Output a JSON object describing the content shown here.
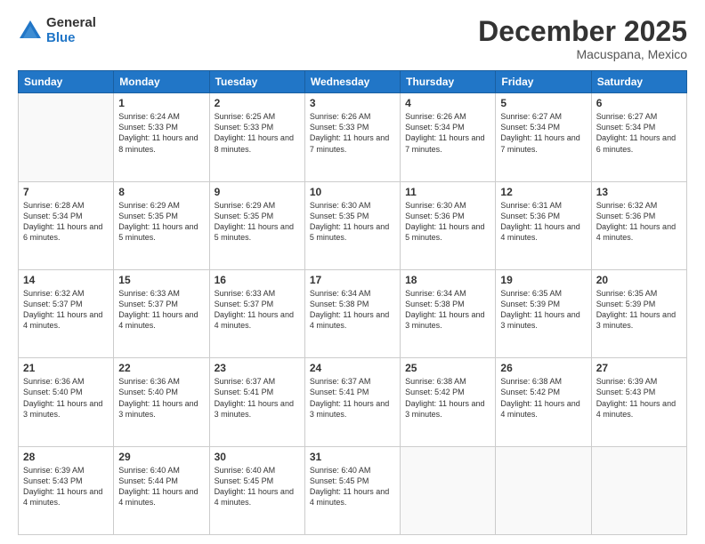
{
  "header": {
    "logo_general": "General",
    "logo_blue": "Blue",
    "month_title": "December 2025",
    "location": "Macuspana, Mexico"
  },
  "days_of_week": [
    "Sunday",
    "Monday",
    "Tuesday",
    "Wednesday",
    "Thursday",
    "Friday",
    "Saturday"
  ],
  "weeks": [
    [
      {
        "day": "",
        "sunrise": "",
        "sunset": "",
        "daylight": ""
      },
      {
        "day": "1",
        "sunrise": "Sunrise: 6:24 AM",
        "sunset": "Sunset: 5:33 PM",
        "daylight": "Daylight: 11 hours and 8 minutes."
      },
      {
        "day": "2",
        "sunrise": "Sunrise: 6:25 AM",
        "sunset": "Sunset: 5:33 PM",
        "daylight": "Daylight: 11 hours and 8 minutes."
      },
      {
        "day": "3",
        "sunrise": "Sunrise: 6:26 AM",
        "sunset": "Sunset: 5:33 PM",
        "daylight": "Daylight: 11 hours and 7 minutes."
      },
      {
        "day": "4",
        "sunrise": "Sunrise: 6:26 AM",
        "sunset": "Sunset: 5:34 PM",
        "daylight": "Daylight: 11 hours and 7 minutes."
      },
      {
        "day": "5",
        "sunrise": "Sunrise: 6:27 AM",
        "sunset": "Sunset: 5:34 PM",
        "daylight": "Daylight: 11 hours and 7 minutes."
      },
      {
        "day": "6",
        "sunrise": "Sunrise: 6:27 AM",
        "sunset": "Sunset: 5:34 PM",
        "daylight": "Daylight: 11 hours and 6 minutes."
      }
    ],
    [
      {
        "day": "7",
        "sunrise": "Sunrise: 6:28 AM",
        "sunset": "Sunset: 5:34 PM",
        "daylight": "Daylight: 11 hours and 6 minutes."
      },
      {
        "day": "8",
        "sunrise": "Sunrise: 6:29 AM",
        "sunset": "Sunset: 5:35 PM",
        "daylight": "Daylight: 11 hours and 5 minutes."
      },
      {
        "day": "9",
        "sunrise": "Sunrise: 6:29 AM",
        "sunset": "Sunset: 5:35 PM",
        "daylight": "Daylight: 11 hours and 5 minutes."
      },
      {
        "day": "10",
        "sunrise": "Sunrise: 6:30 AM",
        "sunset": "Sunset: 5:35 PM",
        "daylight": "Daylight: 11 hours and 5 minutes."
      },
      {
        "day": "11",
        "sunrise": "Sunrise: 6:30 AM",
        "sunset": "Sunset: 5:36 PM",
        "daylight": "Daylight: 11 hours and 5 minutes."
      },
      {
        "day": "12",
        "sunrise": "Sunrise: 6:31 AM",
        "sunset": "Sunset: 5:36 PM",
        "daylight": "Daylight: 11 hours and 4 minutes."
      },
      {
        "day": "13",
        "sunrise": "Sunrise: 6:32 AM",
        "sunset": "Sunset: 5:36 PM",
        "daylight": "Daylight: 11 hours and 4 minutes."
      }
    ],
    [
      {
        "day": "14",
        "sunrise": "Sunrise: 6:32 AM",
        "sunset": "Sunset: 5:37 PM",
        "daylight": "Daylight: 11 hours and 4 minutes."
      },
      {
        "day": "15",
        "sunrise": "Sunrise: 6:33 AM",
        "sunset": "Sunset: 5:37 PM",
        "daylight": "Daylight: 11 hours and 4 minutes."
      },
      {
        "day": "16",
        "sunrise": "Sunrise: 6:33 AM",
        "sunset": "Sunset: 5:37 PM",
        "daylight": "Daylight: 11 hours and 4 minutes."
      },
      {
        "day": "17",
        "sunrise": "Sunrise: 6:34 AM",
        "sunset": "Sunset: 5:38 PM",
        "daylight": "Daylight: 11 hours and 4 minutes."
      },
      {
        "day": "18",
        "sunrise": "Sunrise: 6:34 AM",
        "sunset": "Sunset: 5:38 PM",
        "daylight": "Daylight: 11 hours and 3 minutes."
      },
      {
        "day": "19",
        "sunrise": "Sunrise: 6:35 AM",
        "sunset": "Sunset: 5:39 PM",
        "daylight": "Daylight: 11 hours and 3 minutes."
      },
      {
        "day": "20",
        "sunrise": "Sunrise: 6:35 AM",
        "sunset": "Sunset: 5:39 PM",
        "daylight": "Daylight: 11 hours and 3 minutes."
      }
    ],
    [
      {
        "day": "21",
        "sunrise": "Sunrise: 6:36 AM",
        "sunset": "Sunset: 5:40 PM",
        "daylight": "Daylight: 11 hours and 3 minutes."
      },
      {
        "day": "22",
        "sunrise": "Sunrise: 6:36 AM",
        "sunset": "Sunset: 5:40 PM",
        "daylight": "Daylight: 11 hours and 3 minutes."
      },
      {
        "day": "23",
        "sunrise": "Sunrise: 6:37 AM",
        "sunset": "Sunset: 5:41 PM",
        "daylight": "Daylight: 11 hours and 3 minutes."
      },
      {
        "day": "24",
        "sunrise": "Sunrise: 6:37 AM",
        "sunset": "Sunset: 5:41 PM",
        "daylight": "Daylight: 11 hours and 3 minutes."
      },
      {
        "day": "25",
        "sunrise": "Sunrise: 6:38 AM",
        "sunset": "Sunset: 5:42 PM",
        "daylight": "Daylight: 11 hours and 3 minutes."
      },
      {
        "day": "26",
        "sunrise": "Sunrise: 6:38 AM",
        "sunset": "Sunset: 5:42 PM",
        "daylight": "Daylight: 11 hours and 4 minutes."
      },
      {
        "day": "27",
        "sunrise": "Sunrise: 6:39 AM",
        "sunset": "Sunset: 5:43 PM",
        "daylight": "Daylight: 11 hours and 4 minutes."
      }
    ],
    [
      {
        "day": "28",
        "sunrise": "Sunrise: 6:39 AM",
        "sunset": "Sunset: 5:43 PM",
        "daylight": "Daylight: 11 hours and 4 minutes."
      },
      {
        "day": "29",
        "sunrise": "Sunrise: 6:40 AM",
        "sunset": "Sunset: 5:44 PM",
        "daylight": "Daylight: 11 hours and 4 minutes."
      },
      {
        "day": "30",
        "sunrise": "Sunrise: 6:40 AM",
        "sunset": "Sunset: 5:45 PM",
        "daylight": "Daylight: 11 hours and 4 minutes."
      },
      {
        "day": "31",
        "sunrise": "Sunrise: 6:40 AM",
        "sunset": "Sunset: 5:45 PM",
        "daylight": "Daylight: 11 hours and 4 minutes."
      },
      {
        "day": "",
        "sunrise": "",
        "sunset": "",
        "daylight": ""
      },
      {
        "day": "",
        "sunrise": "",
        "sunset": "",
        "daylight": ""
      },
      {
        "day": "",
        "sunrise": "",
        "sunset": "",
        "daylight": ""
      }
    ]
  ]
}
